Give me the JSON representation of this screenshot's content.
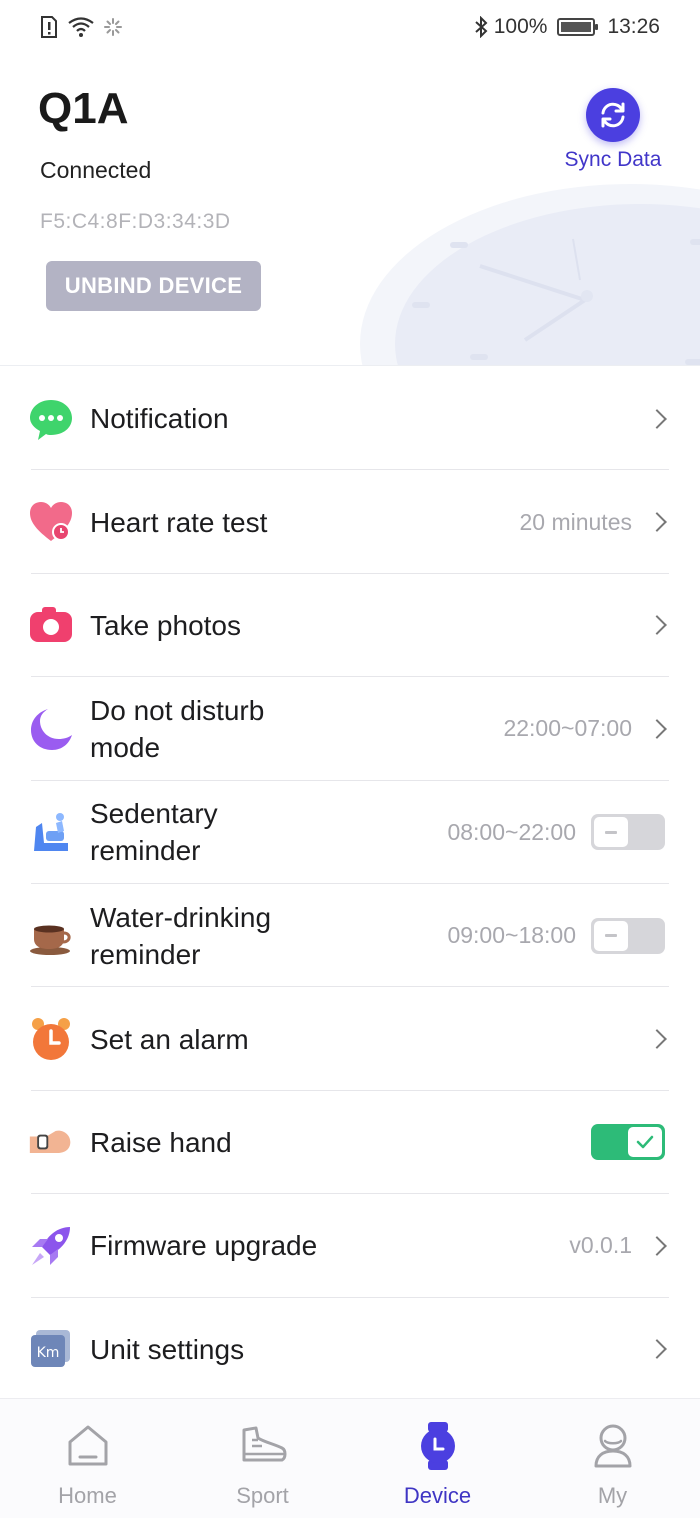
{
  "status_bar": {
    "battery": "100%",
    "time": "13:26"
  },
  "device": {
    "name": "Q1A",
    "status": "Connected",
    "mac": "F5:C4:8F:D3:34:3D",
    "unbind_label": "UNBIND DEVICE",
    "sync_label": "Sync Data"
  },
  "settings": [
    {
      "label": "Notification",
      "value": "",
      "control": "chevron",
      "icon": "chat-bubble-icon"
    },
    {
      "label": "Heart rate test",
      "value": "20 minutes",
      "control": "chevron",
      "icon": "heart-icon"
    },
    {
      "label": "Take photos",
      "value": "",
      "control": "chevron",
      "icon": "camera-icon"
    },
    {
      "label": "Do not disturb mode",
      "value": "22:00~07:00",
      "control": "chevron",
      "icon": "moon-icon"
    },
    {
      "label": "Sedentary reminder",
      "value": "08:00~22:00",
      "control": "toggle-off",
      "icon": "sedentary-icon"
    },
    {
      "label": "Water-drinking reminder",
      "value": "09:00~18:00",
      "control": "toggle-off",
      "icon": "coffee-cup-icon"
    },
    {
      "label": "Set an alarm",
      "value": "",
      "control": "chevron",
      "icon": "alarm-clock-icon"
    },
    {
      "label": "Raise hand",
      "value": "",
      "control": "toggle-on",
      "icon": "raise-hand-icon"
    },
    {
      "label": "Firmware upgrade",
      "value": "v0.0.1",
      "control": "chevron",
      "icon": "rocket-icon"
    },
    {
      "label": "Unit settings",
      "value": "",
      "control": "chevron",
      "icon": "km-icon",
      "icon_text": "Km"
    }
  ],
  "bottom_nav": {
    "home": "Home",
    "sport": "Sport",
    "device": "Device",
    "my": "My",
    "active": "device"
  },
  "colors": {
    "accent": "#4b3fe0",
    "toggle_on": "#2dbb78",
    "toggle_off": "#d6d6da"
  }
}
